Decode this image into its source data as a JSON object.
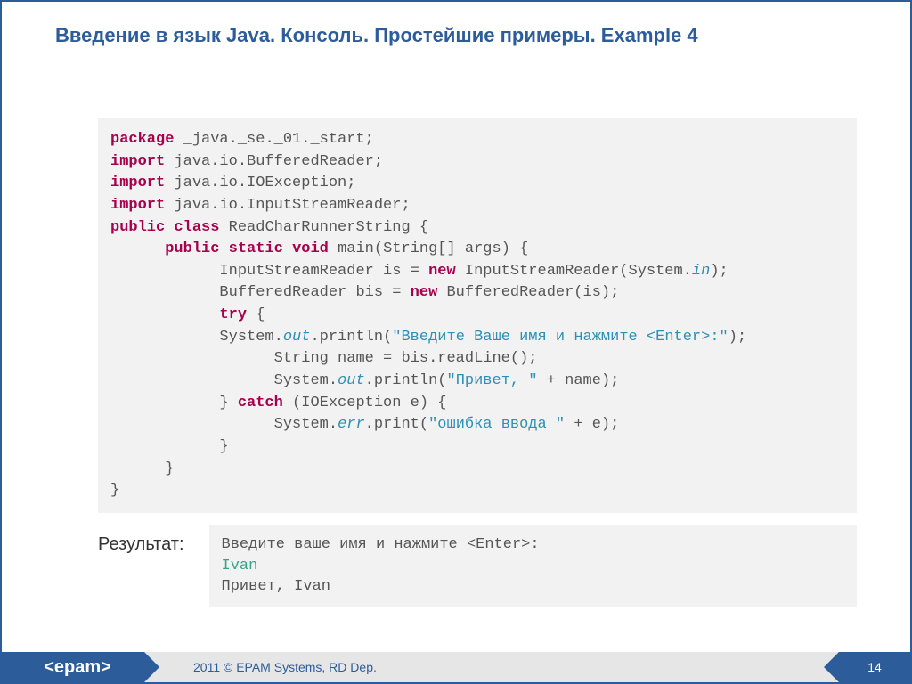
{
  "title": "Введение в язык Java. Консоль. Простейшие примеры. Example 4",
  "code": {
    "kw_package": "package",
    "pkg_line": " _java._se._01._start;",
    "kw_import1": "import",
    "import1": " java.io.BufferedReader;",
    "kw_import2": "import",
    "import2": " java.io.IOException;",
    "kw_import3": "import",
    "import3": " java.io.InputStreamReader;",
    "kw_public1": "public",
    "kw_class": "class",
    "classname": " ReadCharRunnerString {",
    "indent1": "      ",
    "kw_public2": "public",
    "kw_static": "static",
    "kw_void": "void",
    "main_sig": " main(String[] args) {",
    "indent2": "            ",
    "isr_a": "InputStreamReader is = ",
    "kw_new1": "new",
    "isr_b": " InputStreamReader(System.",
    "in": "in",
    "isr_c": ");",
    "br_a": "BufferedReader bis = ",
    "kw_new2": "new",
    "br_b": " BufferedReader(is);",
    "kw_try": "try",
    "try_b": " {",
    "sysout1_a": "System.",
    "out": "out",
    "sysout1_b": ".println(",
    "str1": "\"Введите Ваше имя и нажмите <Enter>:\"",
    "sysout1_c": ");",
    "indent3": "                  ",
    "readline": "String name = bis.readLine();",
    "sysout2_a": "System.",
    "sysout2_b": ".println(",
    "str2": "\"Привет, \"",
    "sysout2_c": " + name);",
    "catch_a": "} ",
    "kw_catch": "catch",
    "catch_b": " (IOException e) {",
    "syserr_a": "System.",
    "err": "err",
    "syserr_b": ".print(",
    "str3": "\"ошибка ввода \"",
    "syserr_c": " + e);",
    "brace_close": "}"
  },
  "result_label": "Результат:",
  "result": {
    "line1": "Введите ваше имя и нажмите <Enter>:",
    "line2": "Ivan",
    "line3": "Привет, Ivan"
  },
  "footer": {
    "logo": "<epam>",
    "copyright": "2011 © EPAM Systems, RD Dep.",
    "page": "14"
  }
}
